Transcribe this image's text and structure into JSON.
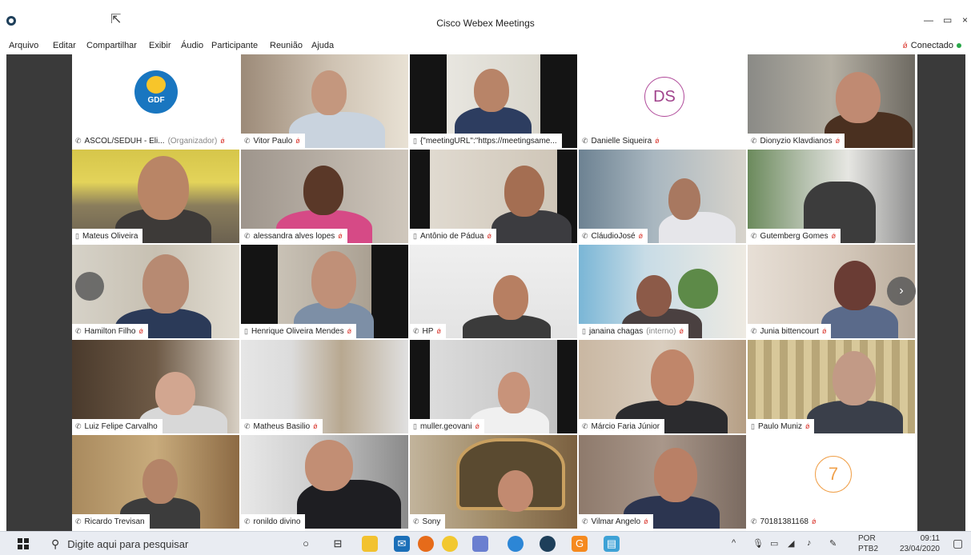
{
  "window": {
    "title": "Cisco Webex Meetings",
    "status": "Conectado"
  },
  "menu": [
    "Arquivo",
    "Editar",
    "Compartilhar",
    "Exibir",
    "Áudio",
    "Participante",
    "Reunião",
    "Ajuda"
  ],
  "logo": {
    "text": "GDF"
  },
  "participants": [
    {
      "name": "ASCOL/SEDUH - Eli...",
      "extra": "(Organizador)",
      "icon": "phone-icon",
      "muted": true
    },
    {
      "name": "Vitor Paulo",
      "icon": "phone-icon",
      "muted": true
    },
    {
      "name": "{\"meetingURL\":\"https://meetingsame...",
      "icon": "device-icon",
      "muted": false
    },
    {
      "name": "Danielle Siqueira",
      "icon": "phone-icon",
      "muted": true,
      "initials": "DS"
    },
    {
      "name": "Dionyzio Klavdianos",
      "icon": "phone-icon",
      "muted": true
    },
    {
      "name": "Mateus Oliveira",
      "icon": "device-icon",
      "muted": false
    },
    {
      "name": "alessandra alves lopes",
      "icon": "phone-icon",
      "muted": true
    },
    {
      "name": "Antônio de Pádua",
      "icon": "device-icon",
      "muted": true
    },
    {
      "name": "CláudioJosé",
      "icon": "phone-icon",
      "muted": true
    },
    {
      "name": "Gutemberg Gomes",
      "icon": "phone-icon",
      "muted": true
    },
    {
      "name": "Hamilton Filho",
      "icon": "phone-icon",
      "muted": true
    },
    {
      "name": "Henrique Oliveira Mendes",
      "icon": "device-icon",
      "muted": true
    },
    {
      "name": "HP",
      "icon": "phone-icon",
      "muted": true
    },
    {
      "name": "janaina chagas",
      "extra": "(interno)",
      "icon": "device-icon",
      "muted": true
    },
    {
      "name": "Junia bittencourt",
      "icon": "phone-icon",
      "muted": true
    },
    {
      "name": "Luiz Felipe  Carvalho",
      "icon": "phone-icon",
      "muted": false
    },
    {
      "name": "Matheus Basilio",
      "icon": "phone-icon",
      "muted": true
    },
    {
      "name": "muller.geovani",
      "icon": "device-icon",
      "muted": true
    },
    {
      "name": "Márcio Faria Júnior",
      "icon": "phone-icon",
      "muted": false
    },
    {
      "name": "Paulo Muniz",
      "icon": "device-icon",
      "muted": true
    },
    {
      "name": "Ricardo Trevisan",
      "icon": "phone-icon",
      "muted": false
    },
    {
      "name": "ronildo divino",
      "icon": "phone-icon",
      "muted": false
    },
    {
      "name": "Sony",
      "icon": "phone-icon",
      "muted": false
    },
    {
      "name": "Vilmar Angelo",
      "icon": "phone-icon",
      "muted": true
    },
    {
      "name": "70181381168",
      "icon": "phone-icon",
      "muted": true,
      "number": "7"
    }
  ],
  "taskbar": {
    "search_placeholder": "Digite aqui para pesquisar",
    "lang_top": "POR",
    "lang_bottom": "PTB2",
    "time": "09:11",
    "date": "23/04/2020"
  },
  "colors": {
    "muted": "#d9342b",
    "connected": "#2aa84a",
    "taskbar": "#e9ecf2"
  }
}
